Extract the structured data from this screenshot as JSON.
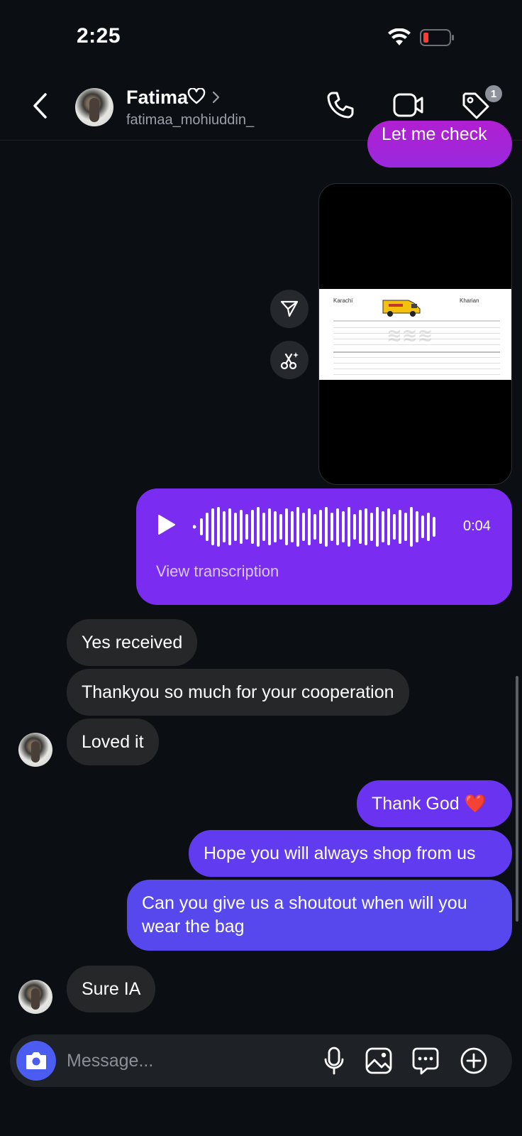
{
  "status_bar": {
    "time": "2:25"
  },
  "header": {
    "contact_name": "Fatima",
    "handle": "fatimaa_mohiuddin_",
    "tag_badge_count": "1"
  },
  "messages": {
    "cut_off": "Let me check",
    "document": {
      "city_from": "Karachi",
      "city_to": "Kharian"
    },
    "voice": {
      "duration": "0:04",
      "transcription_link": "View transcription"
    },
    "received_1": "Yes received",
    "received_2": "Thankyou so much for your cooperation",
    "received_3": "Loved it",
    "sent_1": "Thank God ❤️",
    "sent_2": "Hope you will always shop from us",
    "sent_3_line1": "Can you give us a shoutout when will you",
    "sent_3_line2": "wear the bag",
    "received_4": "Sure IA"
  },
  "composer": {
    "placeholder": "Message..."
  },
  "colors": {
    "background": "#0b0e13",
    "incoming_bubble": "#262729",
    "outgoing_gradient_top": "#7a2cf0",
    "outgoing_gradient_bottom": "#5249ee",
    "camera_button": "#4b5cf0"
  },
  "icons": [
    "back-icon",
    "heart-icon",
    "chevron-right-icon",
    "phone-icon",
    "video-icon",
    "tag-icon",
    "share-icon",
    "scissors-sparkle-icon",
    "play-icon",
    "camera-icon",
    "microphone-icon",
    "image-icon",
    "sticker-chat-icon",
    "plus-circle-icon"
  ]
}
